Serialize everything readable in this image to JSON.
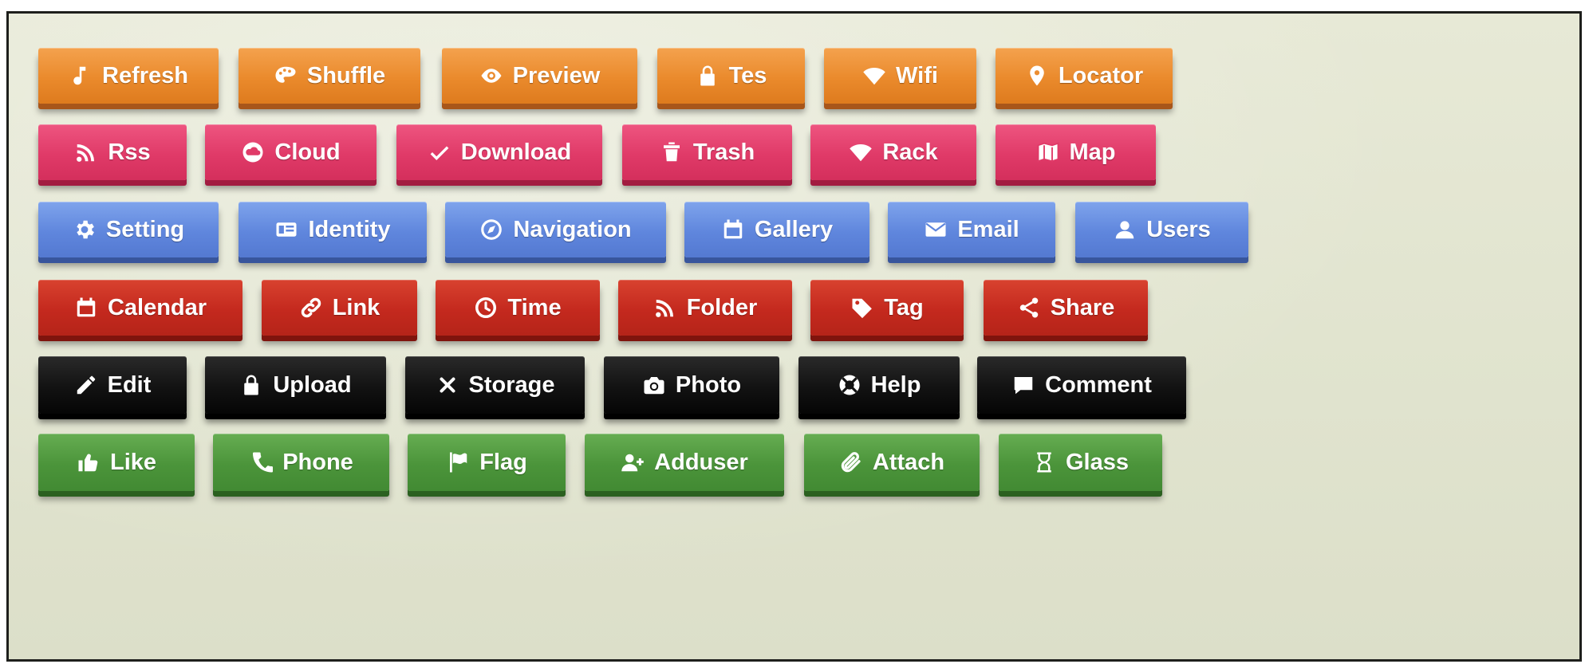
{
  "palette": {
    "orange": "#ea8a2c",
    "pink": "#e03a68",
    "blue": "#5f86dd",
    "red": "#c4291e",
    "black": "#121212",
    "green": "#4b943a",
    "background": "#e1e4cf"
  },
  "rows": [
    {
      "color": "orange",
      "buttons": [
        {
          "label": "Refresh",
          "icon": "music-icon"
        },
        {
          "label": "Shuffle",
          "icon": "palette-icon"
        },
        {
          "label": "Preview",
          "icon": "eye-icon"
        },
        {
          "label": "Tes",
          "icon": "lock-icon"
        },
        {
          "label": "Wifi",
          "icon": "wifi-icon"
        },
        {
          "label": "Locator",
          "icon": "map-pin-icon"
        }
      ]
    },
    {
      "color": "pink",
      "buttons": [
        {
          "label": "Rss",
          "icon": "rss-icon"
        },
        {
          "label": "Cloud",
          "icon": "cloud-icon"
        },
        {
          "label": "Download",
          "icon": "check-icon"
        },
        {
          "label": "Trash",
          "icon": "trash-icon"
        },
        {
          "label": "Rack",
          "icon": "wifi-icon"
        },
        {
          "label": "Map",
          "icon": "map-icon"
        }
      ]
    },
    {
      "color": "blue",
      "buttons": [
        {
          "label": "Setting",
          "icon": "gear-icon"
        },
        {
          "label": "Identity",
          "icon": "id-card-icon"
        },
        {
          "label": "Navigation",
          "icon": "compass-icon"
        },
        {
          "label": "Gallery",
          "icon": "calendar-icon"
        },
        {
          "label": "Email",
          "icon": "envelope-icon"
        },
        {
          "label": "Users",
          "icon": "user-icon"
        }
      ]
    },
    {
      "color": "red",
      "buttons": [
        {
          "label": "Calendar",
          "icon": "calendar-icon"
        },
        {
          "label": "Link",
          "icon": "link-icon"
        },
        {
          "label": "Time",
          "icon": "clock-icon"
        },
        {
          "label": "Folder",
          "icon": "rss-icon"
        },
        {
          "label": "Tag",
          "icon": "tag-icon"
        },
        {
          "label": "Share",
          "icon": "share-icon"
        }
      ]
    },
    {
      "color": "black",
      "buttons": [
        {
          "label": "Edit",
          "icon": "pencil-icon"
        },
        {
          "label": "Upload",
          "icon": "lock-icon"
        },
        {
          "label": "Storage",
          "icon": "close-icon"
        },
        {
          "label": "Photo",
          "icon": "camera-icon"
        },
        {
          "label": "Help",
          "icon": "lifebuoy-icon"
        },
        {
          "label": "Comment",
          "icon": "comment-icon"
        }
      ]
    },
    {
      "color": "green",
      "buttons": [
        {
          "label": "Like",
          "icon": "thumbs-up-icon"
        },
        {
          "label": "Phone",
          "icon": "phone-icon"
        },
        {
          "label": "Flag",
          "icon": "flag-icon"
        },
        {
          "label": "Adduser",
          "icon": "add-user-icon"
        },
        {
          "label": "Attach",
          "icon": "paperclip-icon"
        },
        {
          "label": "Glass",
          "icon": "hourglass-icon"
        }
      ]
    }
  ]
}
